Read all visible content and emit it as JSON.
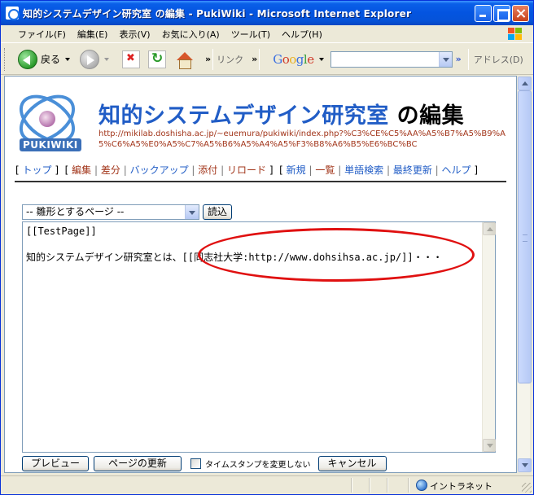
{
  "window": {
    "title": "知的システムデザイン研究室 の編集 - PukiWiki - Microsoft Internet Explorer"
  },
  "menubar": {
    "items": [
      "ファイル(F)",
      "編集(E)",
      "表示(V)",
      "お気に入り(A)",
      "ツール(T)",
      "ヘルプ(H)"
    ]
  },
  "toolbar": {
    "back_label": "戻る",
    "links_label": "リンク",
    "google_label": "Google",
    "address_label": "アドレス(D)",
    "chevron": "»"
  },
  "page": {
    "logo_text": "PUKIWIKI",
    "title_link": "知的システムデザイン研究室",
    "title_suffix": "の編集",
    "url": "http://mikilab.doshisha.ac.jp/~euemura/pukiwiki/index.php?%C3%CE%C5%AA%A5%B7%A5%B9%A5%C6%A5%E0%A5%C7%A5%B6%A5%A4%A5%F3%B8%A6%B5%E6%BC%BC",
    "nav": {
      "top": "トップ",
      "edit": "編集",
      "diff": "差分",
      "backup": "バックアップ",
      "attach": "添付",
      "reload": "リロード",
      "new": "新規",
      "list": "一覧",
      "search": "単語検索",
      "recent": "最終更新",
      "help": "ヘルプ"
    }
  },
  "form": {
    "template_select": "-- 雛形とするページ --",
    "load_button": "読込",
    "editor_line1": "[[TestPage]]",
    "editor_line2": "知的システムデザイン研究室とは、[[同志社大学:http://www.dohsihsa.ac.jp/]]・・・",
    "preview_button": "プレビュー",
    "update_button": "ページの更新",
    "timestamp_label": "タイムスタンプを変更しない",
    "cancel_button": "キャンセル"
  },
  "status": {
    "zone": "イントラネット"
  },
  "colors": {
    "link": "#215DC6",
    "url": "#A2351A",
    "highlight_ellipse": "#E01010"
  }
}
